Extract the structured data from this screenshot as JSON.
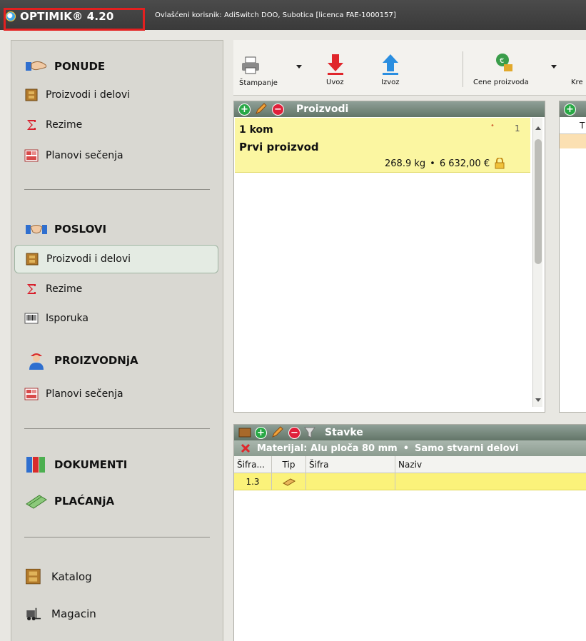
{
  "titlebar": {
    "app_name": "OPTIMIK® 4.20",
    "license": "Ovlašćeni korisnik: AdiSwitch DOO, Subotica [licenca FAE-1000157]"
  },
  "sidebar": {
    "ponude": {
      "title": "PONUDE",
      "items": [
        "Proizvodi i delovi",
        "Rezime",
        "Planovi sečenja"
      ]
    },
    "poslovi": {
      "title": "POSLOVI",
      "items": [
        "Proizvodi i delovi",
        "Rezime",
        "Isporuka"
      ],
      "active_index": 0
    },
    "proizvodnja": {
      "title": "PROIZVODNjA",
      "items": [
        "Planovi sečenja"
      ]
    },
    "dokumenti": {
      "title": "DOKUMENTI"
    },
    "placanja": {
      "title": "PLAĆANjA"
    },
    "bottom_items": [
      "Katalog",
      "Magacin"
    ]
  },
  "toolbar": {
    "print": "Štampanje",
    "import": "Uvoz",
    "export": "Izvoz",
    "prices": "Cene proizvoda",
    "cut_label": "Kre"
  },
  "products_panel": {
    "title": "Proizvodi",
    "card": {
      "qty": "1 kom",
      "index": "1",
      "name": "Prvi proizvod",
      "weight": "268.9 kg",
      "price": "6 632,00 €",
      "separator": "•"
    }
  },
  "right_panel": {
    "col": "T"
  },
  "stavke_panel": {
    "title": "Stavke",
    "filter": "Materijal: Alu ploča 80 mm",
    "filter2": "Samo stvarni delovi",
    "filter_sep": "•",
    "columns": [
      "Šifra...",
      "Tip",
      "Šifra",
      "Naziv"
    ],
    "rows": [
      {
        "sifra": "1.3",
        "tip": "",
        "sifra2": "",
        "naziv": ""
      }
    ]
  }
}
